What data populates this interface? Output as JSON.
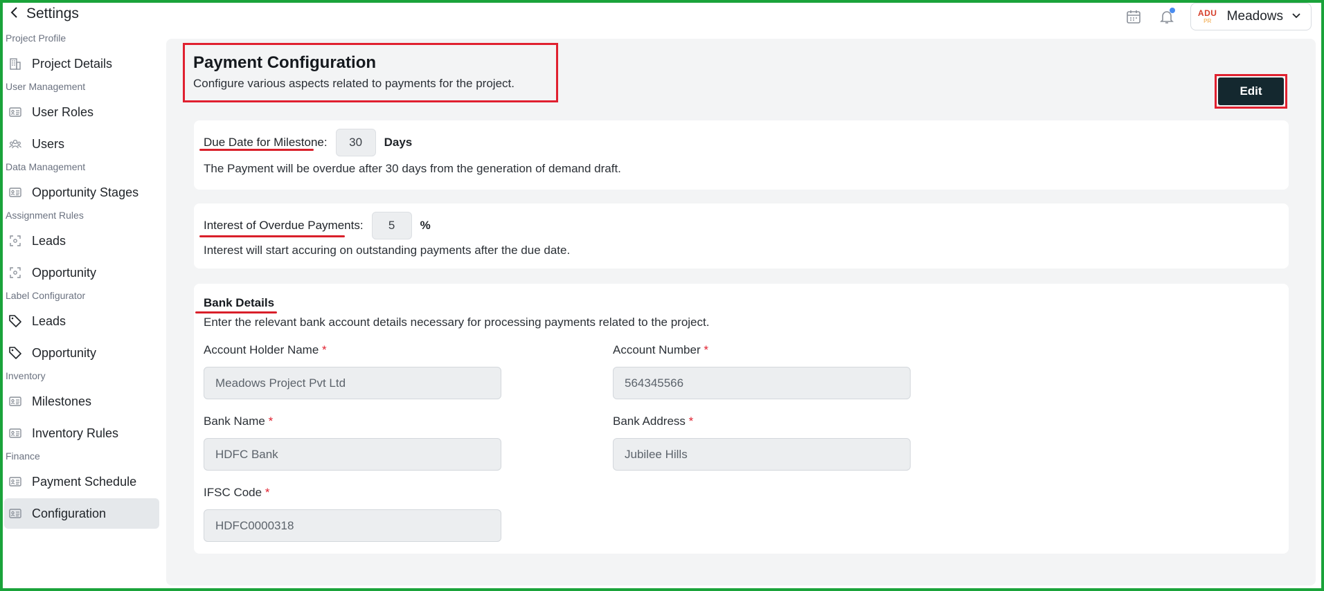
{
  "topbar": {
    "back_label": "Settings",
    "profile_name": "Meadows",
    "logo_line1": "ADU",
    "logo_line2": "PR"
  },
  "sidebar": {
    "sections": [
      {
        "title": "Project Profile",
        "items": [
          {
            "label": "Project Details",
            "icon": "building-icon"
          }
        ]
      },
      {
        "title": "User Management",
        "items": [
          {
            "label": "User Roles",
            "icon": "id-card-icon"
          },
          {
            "label": "Users",
            "icon": "users-icon"
          }
        ]
      },
      {
        "title": "Data Management",
        "items": [
          {
            "label": "Opportunity Stages",
            "icon": "id-card-icon"
          }
        ]
      },
      {
        "title": "Assignment Rules",
        "items": [
          {
            "label": "Leads",
            "icon": "focus-icon"
          },
          {
            "label": "Opportunity",
            "icon": "focus-icon"
          }
        ]
      },
      {
        "title": "Label Configurator",
        "items": [
          {
            "label": "Leads",
            "icon": "tag-icon"
          },
          {
            "label": "Opportunity",
            "icon": "tag-icon"
          }
        ]
      },
      {
        "title": "Inventory",
        "items": [
          {
            "label": "Milestones",
            "icon": "id-card-icon"
          },
          {
            "label": "Inventory Rules",
            "icon": "id-card-icon"
          }
        ]
      },
      {
        "title": "Finance",
        "items": [
          {
            "label": "Payment Schedule",
            "icon": "id-card-icon"
          },
          {
            "label": "Configuration",
            "icon": "id-card-icon",
            "active": true
          }
        ]
      }
    ]
  },
  "main": {
    "title": "Payment Configuration",
    "subtitle": "Configure various aspects related to payments for the project.",
    "edit_label": "Edit",
    "due_date": {
      "label": "Due Date for Milestone:",
      "value": "30",
      "unit": "Days",
      "help": "The Payment will be overdue after 30 days from the generation of demand draft."
    },
    "interest": {
      "label": "Interest of Overdue Payments:",
      "value": "5",
      "unit": "%",
      "help": "Interest will start accuring on outstanding payments after the due date."
    },
    "bank": {
      "title": "Bank Details",
      "desc": "Enter the relevant bank account details necessary for processing payments related to the project.",
      "required_mark": "*",
      "fields": {
        "holder": {
          "label": "Account Holder Name",
          "value": "Meadows Project Pvt Ltd"
        },
        "number": {
          "label": "Account Number",
          "value": "564345566"
        },
        "bank_name": {
          "label": "Bank Name",
          "value": "HDFC Bank"
        },
        "address": {
          "label": "Bank Address",
          "value": "Jubilee Hills"
        },
        "ifsc": {
          "label": "IFSC Code",
          "value": "HDFC0000318"
        }
      }
    }
  },
  "colors": {
    "annotation_red": "#e0202f",
    "frame_green": "#1aa33a",
    "edit_button_bg": "#14282f",
    "active_item_bg": "#e5e8eb"
  }
}
